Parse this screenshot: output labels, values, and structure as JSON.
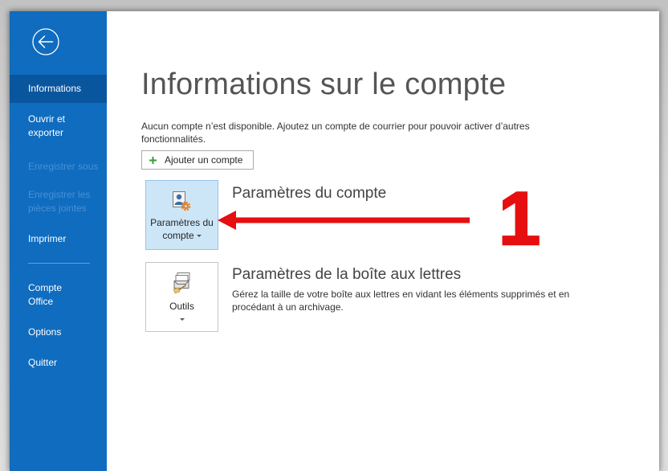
{
  "colors": {
    "sidebar_bg": "#0f6cbf",
    "sidebar_selected_bg": "#0a569e",
    "sidebar_disabled_text": "#4a90d6",
    "tile_selected_bg": "#cde6f7",
    "annotation_red": "#e60e0e",
    "add_icon_green": "#3b9b3b"
  },
  "sidebar": {
    "back_button": {
      "icon": "back-arrow-icon"
    },
    "items": [
      {
        "lines": [
          "Informations"
        ],
        "selected": true,
        "enabled": true
      },
      {
        "lines": [
          "Ouvrir et",
          "exporter"
        ],
        "selected": false,
        "enabled": true
      },
      {
        "lines": [
          "Enregistrer sous"
        ],
        "selected": false,
        "enabled": false
      },
      {
        "lines": [
          "Enregistrer les",
          "pièces jointes"
        ],
        "selected": false,
        "enabled": false
      },
      {
        "lines": [
          "Imprimer"
        ],
        "selected": false,
        "enabled": true
      },
      {
        "lines": [
          "Compte",
          "Office"
        ],
        "selected": false,
        "enabled": true
      },
      {
        "lines": [
          "Options"
        ],
        "selected": false,
        "enabled": true
      },
      {
        "lines": [
          "Quitter"
        ],
        "selected": false,
        "enabled": true
      }
    ]
  },
  "main": {
    "page_title": "Informations sur le compte",
    "notice": "Aucun compte n’est disponible. Ajoutez un compte de courrier pour pouvoir activer d’autres fonctionnalités.",
    "add_account_button": {
      "icon": "plus-icon",
      "label": "Ajouter un compte"
    },
    "sections": [
      {
        "tile": {
          "icon": "account-settings-icon",
          "label": "Paramètres du compte",
          "has_dropdown": true,
          "highlighted": true
        },
        "heading": "Paramètres du compte"
      },
      {
        "tile": {
          "icon": "mailbox-tools-icon",
          "label": "Outils",
          "has_dropdown": true,
          "highlighted": false
        },
        "heading": "Paramètres de la boîte aux lettres",
        "description": "Gérez la taille de votre boîte aux lettres en vidant les éléments supprimés et en procédant à un archivage."
      }
    ]
  },
  "annotation": {
    "arrow_icon": "red-arrow-left-icon",
    "step_number": "1"
  }
}
